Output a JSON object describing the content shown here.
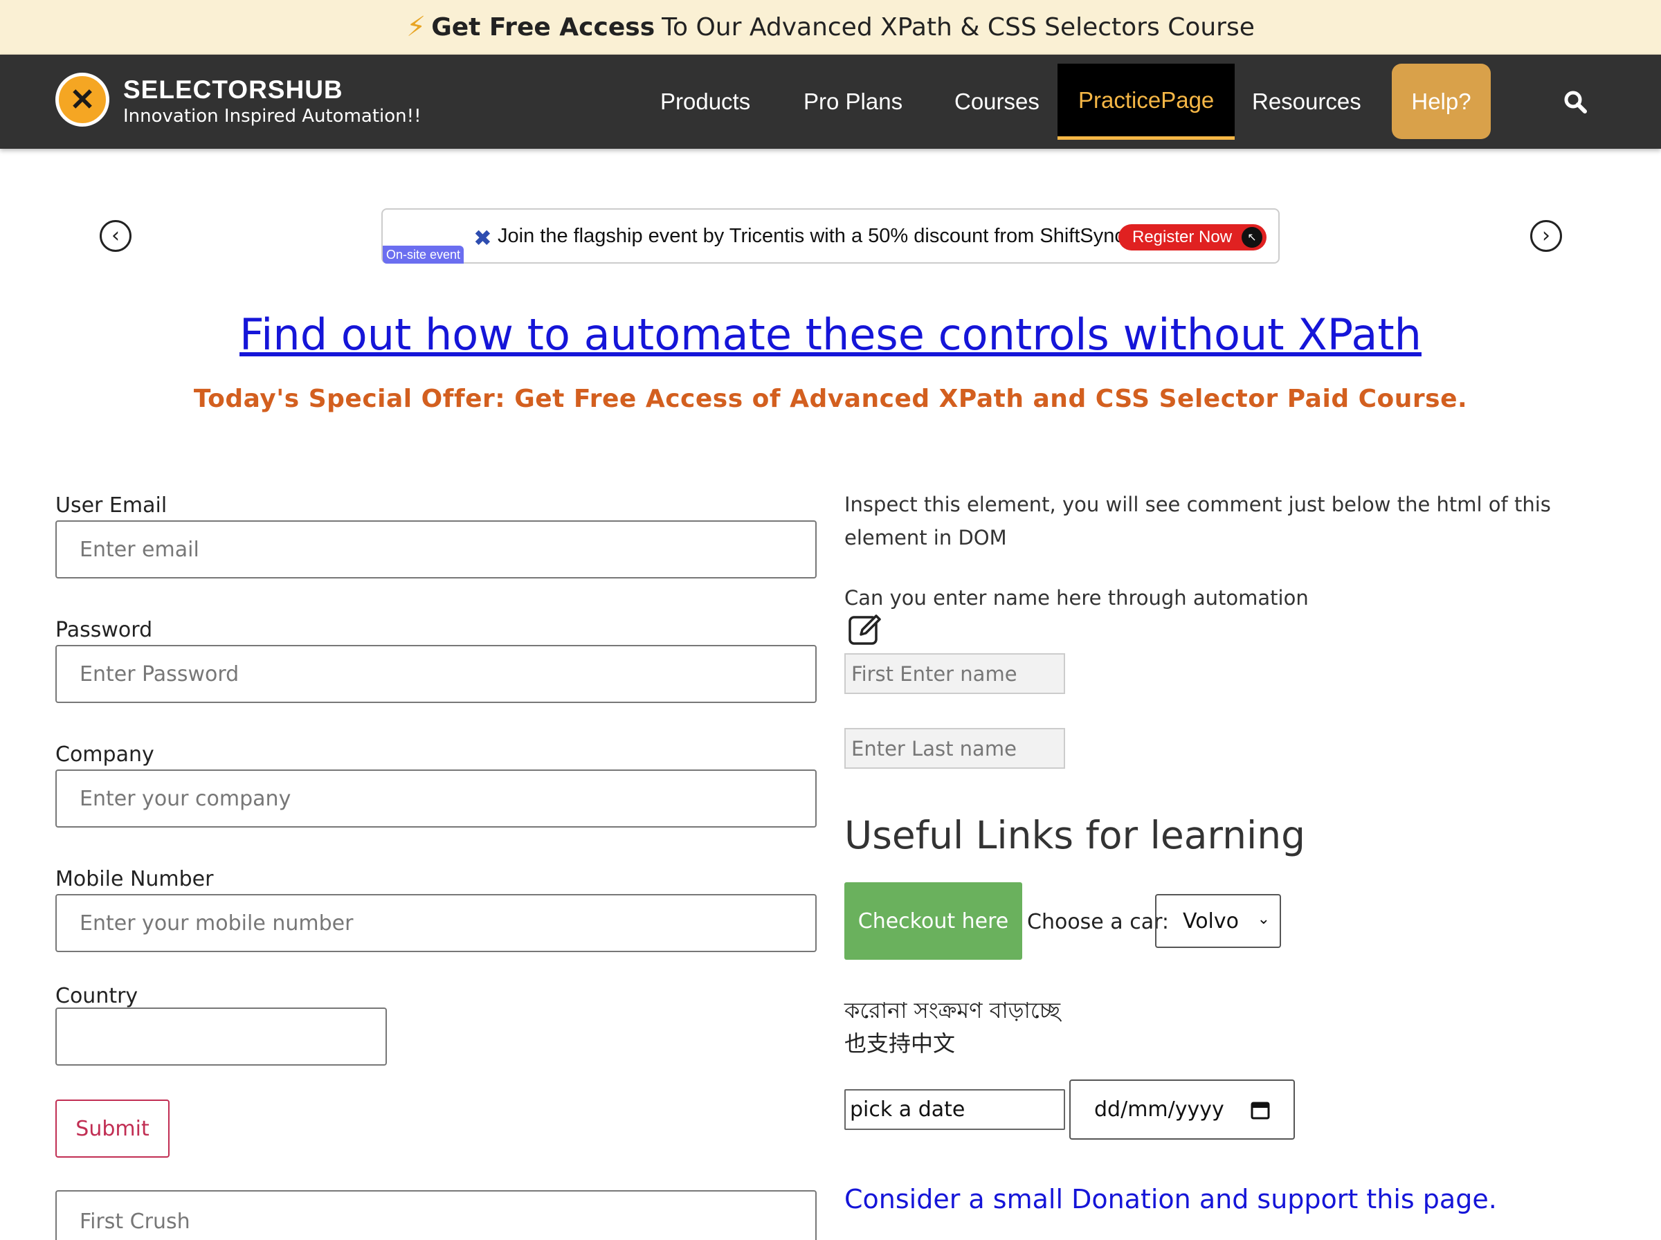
{
  "promo": {
    "bolt_icon": "lightning-icon",
    "strong": "Get Free Access",
    "rest": "To Our Advanced XPath & CSS Selectors Course"
  },
  "brand": {
    "name": "SELECTORSHUB",
    "tagline": "Innovation Inspired Automation!!"
  },
  "nav": {
    "items": [
      {
        "label": "Products"
      },
      {
        "label": "Pro Plans"
      },
      {
        "label": "Courses"
      },
      {
        "label": "PracticePage"
      },
      {
        "label": "Resources"
      }
    ],
    "help": "Help?",
    "active": "PracticePage",
    "search_icon": "search-icon"
  },
  "ad": {
    "text": "Join the flagship event by Tricentis with a 50% discount from ShiftSync",
    "register": "Register Now",
    "badge": "On-site event"
  },
  "headline": "Find out how to automate these controls without XPath",
  "offer": "Today's Special Offer: Get Free Access of Advanced XPath and CSS Selector Paid Course.",
  "form": {
    "email_label": "User Email",
    "email_placeholder": "Enter email",
    "password_label": "Password",
    "password_placeholder": "Enter Password",
    "company_label": "Company",
    "company_placeholder": "Enter your company",
    "mobile_label": "Mobile Number",
    "mobile_placeholder": "Enter your mobile number",
    "country_label": "Country",
    "country_value": "",
    "submit": "Submit",
    "first_crush_placeholder": "First Crush"
  },
  "right": {
    "inspect_text": "Inspect this element, you will see comment just below the html of this element in DOM",
    "enter_name_text": "Can you enter name here through automation",
    "first_name_placeholder": "First Enter name",
    "last_name_placeholder": "Enter Last name",
    "useful_heading": "Useful Links for learning",
    "checkout_button": "Checkout here",
    "car_label": "Choose a car:",
    "car_selected": "Volvo",
    "bengali_text": "করোনা সংক্রমণ বাড়াচ্ছে",
    "chinese_text": "也支持中文",
    "pick_date_value": "pick a date",
    "date_placeholder": "dd/mm/yyyy",
    "donate_link": "Consider a small Donation and support this page."
  },
  "colors": {
    "promo_bg": "#faf0d4",
    "nav_bg": "#323232",
    "accent": "#f6b746",
    "help_bg": "#d9a14a",
    "link": "#1515d8",
    "offer": "#d35f1f",
    "checkout_bg": "#6ab15d",
    "submit": "#c12e53"
  }
}
